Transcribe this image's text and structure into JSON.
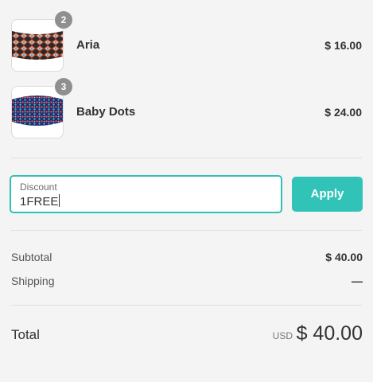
{
  "cart": {
    "items": [
      {
        "qty": "2",
        "name": "Aria",
        "price": "$ 16.00",
        "image": "headband-aztec-thumbnail"
      },
      {
        "qty": "3",
        "name": "Baby Dots",
        "price": "$ 24.00",
        "image": "headband-dots-thumbnail"
      }
    ]
  },
  "discount": {
    "label": "Discount",
    "value": "1FREE",
    "apply_label": "Apply"
  },
  "summary": {
    "subtotal_label": "Subtotal",
    "subtotal_value": "$ 40.00",
    "shipping_label": "Shipping",
    "shipping_value": "—",
    "total_label": "Total",
    "currency": "USD",
    "total_value": "$ 40.00"
  },
  "colors": {
    "accent": "#32c3b8",
    "background": "#f4f4f4",
    "badge": "#8f8f8f"
  }
}
